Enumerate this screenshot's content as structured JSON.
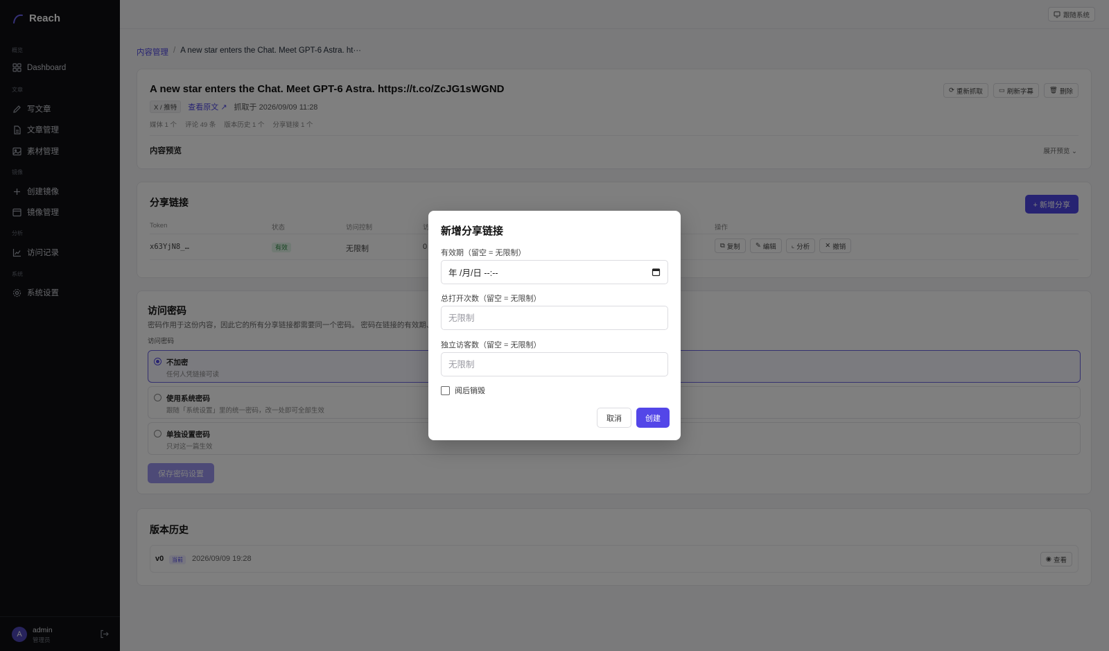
{
  "sidebar": {
    "app_name": "Reach",
    "sections": {
      "overview": "概览",
      "articles": "文章",
      "mirror": "镜像",
      "analytics": "分析",
      "system": "系统"
    },
    "items": {
      "dashboard": "Dashboard",
      "write": "写文章",
      "article_mgmt": "文章管理",
      "asset_mgmt": "素材管理",
      "create_mirror": "创建镜像",
      "mirror_mgmt": "镜像管理",
      "visit_log": "访问记录",
      "settings": "系统设置"
    },
    "user": {
      "avatar_letter": "A",
      "name": "admin",
      "role": "管理员"
    }
  },
  "topbar": {
    "follow_system": "跟随系统"
  },
  "breadcrumb": {
    "parent": "内容管理",
    "separator": "/",
    "current": "A new star enters the Chat. Meet GPT-6 Astra. ht···"
  },
  "content": {
    "title": "A new star enters the Chat. Meet GPT-6 Astra. https://t.co/ZcJG1sWGND",
    "source_tag": "X / 推特",
    "view_original": "查看原文 ↗",
    "grabbed_at": "抓取于 2026/09/09 11:28",
    "stats": [
      "媒体 1 个",
      "评论 49 条",
      "版本历史 1 个",
      "分享链接 1 个"
    ],
    "actions": {
      "refetch": "重新抓取",
      "refresh_subs": "刷新字幕",
      "delete": "删除"
    },
    "preview_label": "内容预览",
    "expand_preview": "展开预览"
  },
  "share_links": {
    "title": "分享链接",
    "new_button": "+ 新增分享",
    "columns": {
      "token": "Token",
      "status": "状态",
      "access": "访问控制",
      "visits_partial": "访",
      "ops": "操作"
    },
    "row": {
      "token": "x63YjN8_…",
      "status": "有效",
      "access": "无限制",
      "visits": "0"
    },
    "row_actions": {
      "copy": "复制",
      "edit": "编辑",
      "analyze": "分析",
      "revoke": "撤销"
    }
  },
  "password": {
    "title": "访问密码",
    "description": "密码作用于这份内容，因此它的所有分享链接都需要同一个密码。 密码在链接的有效期、次数",
    "label": "访问密码",
    "options": [
      {
        "title": "不加密",
        "sub": "任何人凭链接可读",
        "selected": true
      },
      {
        "title": "使用系统密码",
        "sub": "跟随「系统设置」里的统一密码，改一处即可全部生效",
        "selected": false
      },
      {
        "title": "单独设置密码",
        "sub": "只对这一篇生效",
        "selected": false
      }
    ],
    "save_button": "保存密码设置"
  },
  "versions": {
    "title": "版本历史",
    "items": [
      {
        "name": "v0",
        "badge": "当前",
        "time": "2026/09/09 19:28",
        "view": "查看"
      }
    ]
  },
  "modal": {
    "title": "新增分享链接",
    "expiry_label": "有效期（留空 = 无限制）",
    "expiry_value": "年 /月/日 --:--",
    "total_opens_label": "总打开次数（留空 = 无限制）",
    "total_opens_placeholder": "无限制",
    "unique_visitors_label": "独立访客数（留空 = 无限制）",
    "unique_visitors_placeholder": "无限制",
    "burn_after_read": "阅后销毁",
    "cancel": "取消",
    "create": "创建"
  },
  "colors": {
    "accent": "#4f46e5",
    "sidebar_bg": "#0e0f13",
    "overlay": "rgba(0,0,0,0.5)"
  }
}
